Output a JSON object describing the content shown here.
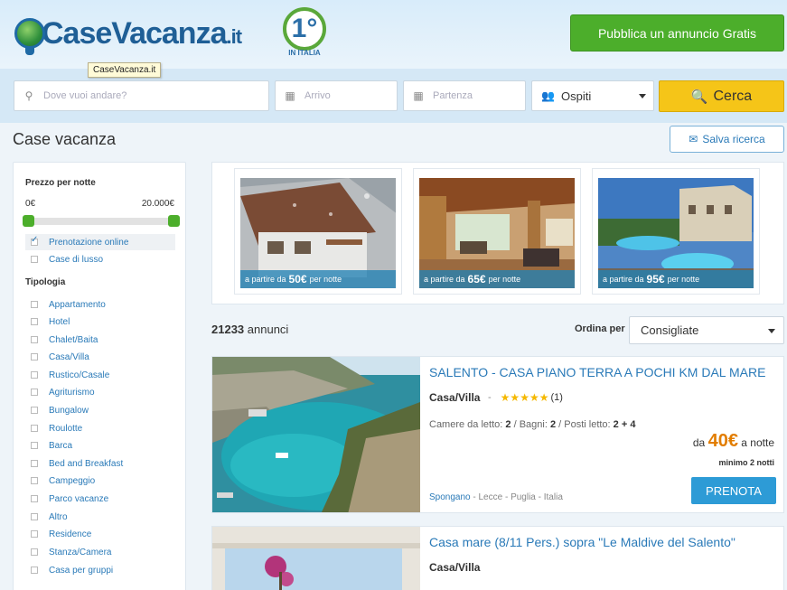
{
  "header": {
    "logo_text": "CaseVacanza",
    "logo_tld": ".it",
    "badge_number": "1°",
    "badge_label": "IN ITALIA",
    "publish_button": "Pubblica un annuncio Gratis",
    "tooltip": "CaseVacanza.it"
  },
  "search": {
    "destination_placeholder": "Dove vuoi andare?",
    "checkin_placeholder": "Arrivo",
    "checkout_placeholder": "Partenza",
    "guests_label": "Ospiti",
    "search_button": "Cerca",
    "icons": {
      "destination": "map-marker-icon",
      "checkin": "calendar-icon",
      "checkout": "calendar-icon",
      "guests": "users-icon",
      "search": "search-icon"
    }
  },
  "page": {
    "title": "Case vacanza",
    "save_search": "Salva ricerca"
  },
  "filters": {
    "price_title": "Prezzo per notte",
    "price_min": "0€",
    "price_max": "20.000€",
    "options": [
      {
        "label": "Prenotazione online",
        "checked": true
      },
      {
        "label": "Case di lusso",
        "checked": false
      }
    ],
    "type_title": "Tipologia",
    "types": [
      "Appartamento",
      "Hotel",
      "Chalet/Baita",
      "Casa/Villa",
      "Rustico/Casale",
      "Agriturismo",
      "Bungalow",
      "Roulotte",
      "Barca",
      "Bed and Breakfast",
      "Campeggio",
      "Parco vacanze",
      "Altro",
      "Residence",
      "Stanza/Camera",
      "Casa per gruppi"
    ]
  },
  "featured": [
    {
      "prefix": "a partire da",
      "price": "50€",
      "suffix": "per notte"
    },
    {
      "prefix": "a partire da",
      "price": "65€",
      "suffix": "per notte"
    },
    {
      "prefix": "a partire da",
      "price": "95€",
      "suffix": "per notte"
    }
  ],
  "results": {
    "count": "21233",
    "count_label": "annunci",
    "order_label": "Ordina per",
    "order_value": "Consigliate"
  },
  "listings": [
    {
      "title": "SALENTO - CASA PIANO TERRA A POCHI KM DAL MARE",
      "type": "Casa/Villa",
      "stars": "★★★★★",
      "reviews": "(1)",
      "details_bedrooms_label": "Camere da letto:",
      "details_bedrooms": "2",
      "details_bathrooms_label": "Bagni:",
      "details_bathrooms": "2",
      "details_beds_label": "Posti letto:",
      "details_beds": "2 + 4",
      "price_prefix": "da",
      "price": "40€",
      "price_suffix": "a notte",
      "minimum": "minimo 2 notti",
      "location_city": "Spongano",
      "location_rest": "- Lecce - Puglia - Italia",
      "book_button": "PRENOTA"
    },
    {
      "title": "Casa mare (8/11 Pers.) sopra \"Le Maldive del Salento\"",
      "type": "Casa/Villa"
    }
  ]
}
